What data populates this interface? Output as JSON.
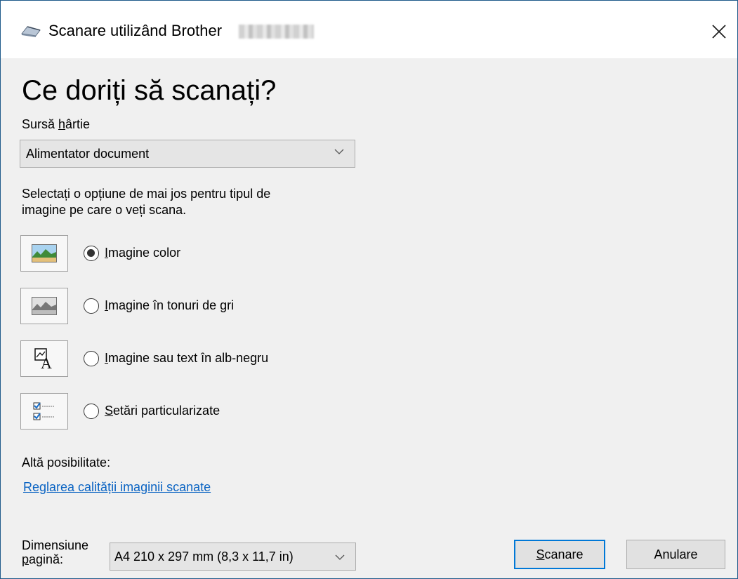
{
  "window": {
    "title": "Scanare utilizând Brother",
    "close_label": "×"
  },
  "main": {
    "heading": "Ce doriți să scanați?",
    "source_label_pre": "Sursă ",
    "source_label_u": "h",
    "source_label_post": "ârtie",
    "source_value": "Alimentator document",
    "instruction_line1": "Selectați o opțiune de mai jos pentru tipul de",
    "instruction_line2": "imagine pe care o veți scana.",
    "options": [
      {
        "u": "I",
        "rest": "magine color",
        "checked": true
      },
      {
        "u": "I",
        "rest": "magine în tonuri de gri",
        "checked": false
      },
      {
        "u": "I",
        "rest": "magine sau text în alb-negru",
        "checked": false
      },
      {
        "u": "S",
        "rest": "etări particularizate",
        "checked": false
      }
    ],
    "other_label": "Altă posibilitate:",
    "link_text": "Reglarea calității imaginii scanate"
  },
  "footer": {
    "page_size_label_line1": "Dimensiune",
    "page_size_label_u": "p",
    "page_size_label_line2_rest": "agină:",
    "page_size_value": "A4 210 x 297 mm (8,3 x 11,7 in)",
    "scan_u": "S",
    "scan_rest": "canare",
    "cancel_label": "Anulare"
  },
  "colors": {
    "accent": "#0078d7",
    "link": "#0b64c3",
    "background": "#f0f0f0"
  },
  "icons": [
    "scanner-icon",
    "color-photo-icon",
    "grayscale-photo-icon",
    "black-white-icon",
    "custom-settings-icon",
    "chevron-down-icon",
    "close-icon"
  ]
}
